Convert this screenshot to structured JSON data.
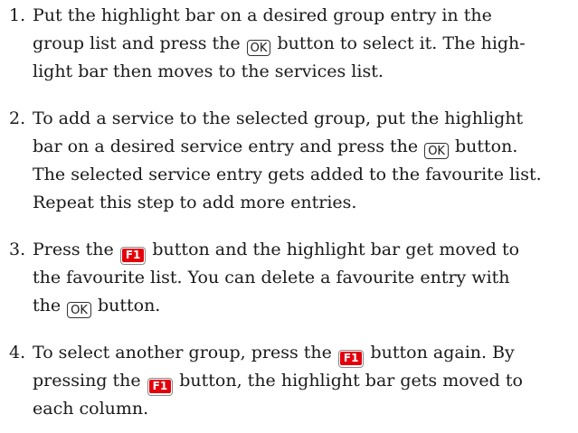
{
  "buttons": {
    "ok": "OK",
    "f1": "F1"
  },
  "steps": [
    {
      "num": "1.",
      "lines": [
        [
          "Put the highlight bar on a desired group entry in the"
        ],
        [
          "group list and press the ",
          "{ok}",
          " button to select it. The high-"
        ],
        [
          "light bar then moves to the services list."
        ]
      ]
    },
    {
      "num": "2.",
      "lines": [
        [
          "To add a service to the selected group, put the highlight"
        ],
        [
          "bar on a desired service entry and press the ",
          "{ok}",
          " button."
        ],
        [
          "The selected service entry gets added to the favourite list."
        ],
        [
          "Repeat this step to add more entries."
        ]
      ]
    },
    {
      "num": "3.",
      "lines": [
        [
          "Press the ",
          "{f1}",
          " button and the highlight bar get moved to"
        ],
        [
          "the favourite list. You can delete a favourite entry with"
        ],
        [
          "the ",
          "{ok}",
          " button."
        ]
      ]
    },
    {
      "num": "4.",
      "lines": [
        [
          "To select another group, press the ",
          "{f1}",
          " button again. By"
        ],
        [
          "pressing the ",
          "{f1}",
          " button, the highlight bar gets moved to"
        ],
        [
          "each column."
        ]
      ]
    }
  ]
}
